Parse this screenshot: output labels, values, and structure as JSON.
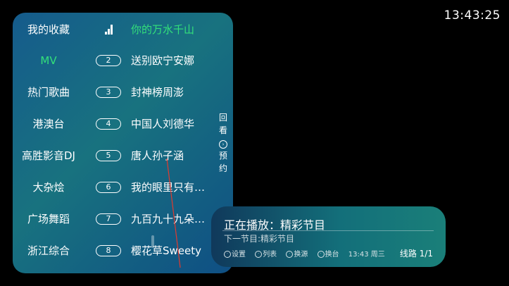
{
  "clock": "13:43:25",
  "categories": [
    "我的收藏",
    "MV",
    "热门歌曲",
    "港澳台",
    "高胜影音DJ",
    "大杂烩",
    "广场舞蹈",
    "浙江综合"
  ],
  "active_category": 1,
  "channels": [
    {
      "num": "",
      "name": "你的万水千山",
      "active": true,
      "signal_icon": true
    },
    {
      "num": "2",
      "name": "送别欧宁安娜"
    },
    {
      "num": "3",
      "name": "封神榜周澎"
    },
    {
      "num": "4",
      "name": "中国人刘德华"
    },
    {
      "num": "5",
      "name": "唐人孙子涵"
    },
    {
      "num": "6",
      "name": "我的眼里只有…"
    },
    {
      "num": "7",
      "name": "九百九十九朵…"
    },
    {
      "num": "8",
      "name": "樱花草Sweety"
    }
  ],
  "side_menu": {
    "chars": [
      "回",
      "看"
    ],
    "chars2": [
      "预",
      "约"
    ],
    "arrow": "›"
  },
  "info": {
    "now_playing": "正在播放：精彩节目",
    "next": "下一节目:精彩节目",
    "hints": [
      "设置",
      "列表",
      "换源",
      "换台"
    ],
    "time": "13:43 周三",
    "line": "线路 1/1"
  },
  "colors": {
    "accent": "#33e07a"
  }
}
